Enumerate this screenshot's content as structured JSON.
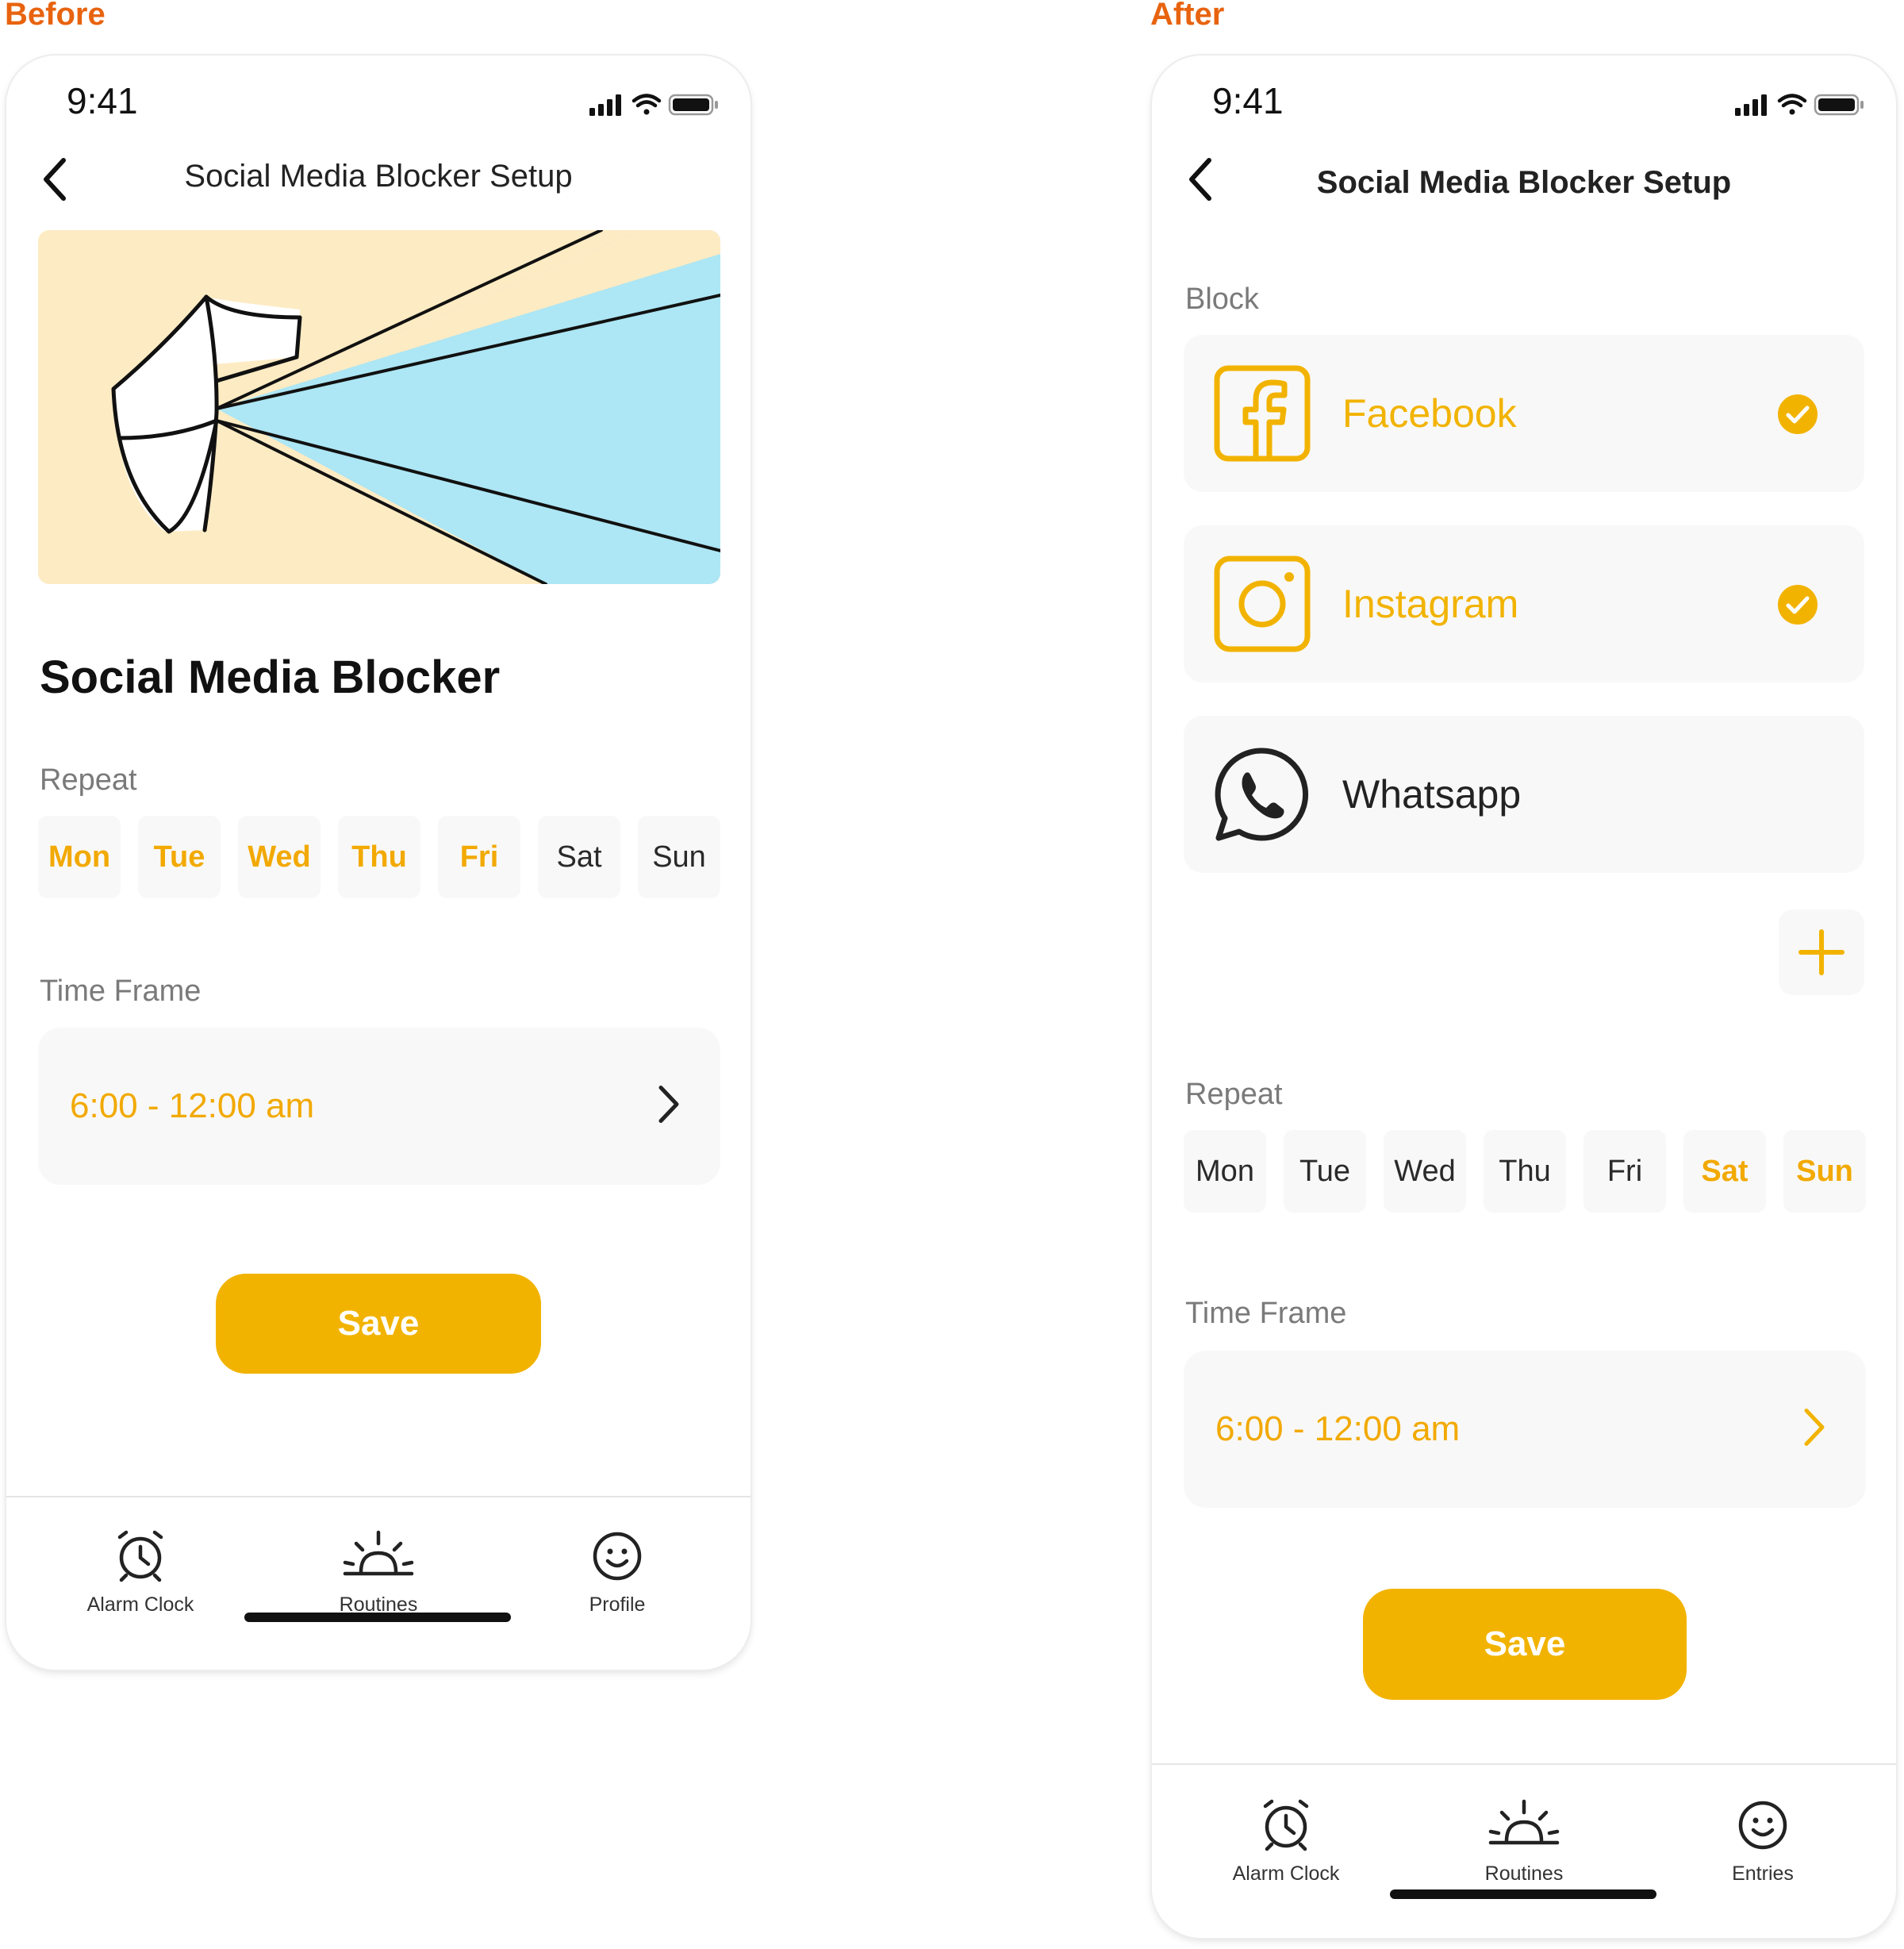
{
  "captions": {
    "before": "Before",
    "after": "After"
  },
  "status": {
    "time": "9:41"
  },
  "before": {
    "nav_title": "Social Media Blocker Setup",
    "heading": "Social Media Blocker",
    "repeat_label": "Repeat",
    "days": [
      {
        "label": "Mon",
        "selected": true
      },
      {
        "label": "Tue",
        "selected": true
      },
      {
        "label": "Wed",
        "selected": true
      },
      {
        "label": "Thu",
        "selected": true
      },
      {
        "label": "Fri",
        "selected": true
      },
      {
        "label": "Sat",
        "selected": false
      },
      {
        "label": "Sun",
        "selected": false
      }
    ],
    "time_frame_label": "Time Frame",
    "time_frame_value": "6:00 - 12:00 am",
    "save_label": "Save",
    "tabs": [
      {
        "label": "Alarm Clock",
        "icon": "alarm-clock-icon"
      },
      {
        "label": "Routines",
        "icon": "sunrise-icon"
      },
      {
        "label": "Profile",
        "icon": "smiley-icon"
      }
    ]
  },
  "after": {
    "nav_title": "Social Media Blocker Setup",
    "block_label": "Block",
    "apps": [
      {
        "name": "Facebook",
        "icon": "facebook-icon",
        "selected": true
      },
      {
        "name": "Instagram",
        "icon": "instagram-icon",
        "selected": true
      },
      {
        "name": "Whatsapp",
        "icon": "whatsapp-icon",
        "selected": false
      }
    ],
    "repeat_label": "Repeat",
    "days": [
      {
        "label": "Mon",
        "selected": false
      },
      {
        "label": "Tue",
        "selected": false
      },
      {
        "label": "Wed",
        "selected": false
      },
      {
        "label": "Thu",
        "selected": false
      },
      {
        "label": "Fri",
        "selected": false
      },
      {
        "label": "Sat",
        "selected": true
      },
      {
        "label": "Sun",
        "selected": true
      }
    ],
    "time_frame_label": "Time Frame",
    "time_frame_value": "6:00 - 12:00 am",
    "save_label": "Save",
    "tabs": [
      {
        "label": "Alarm Clock",
        "icon": "alarm-clock-icon"
      },
      {
        "label": "Routines",
        "icon": "sunrise-icon"
      },
      {
        "label": "Entries",
        "icon": "smiley-icon"
      }
    ]
  },
  "colors": {
    "accent": "#F2B300",
    "caption": "#E8630F",
    "card_bg": "#F8F8F8",
    "illustration_sand": "#FDEBC3",
    "illustration_sky": "#ADE6F4"
  }
}
